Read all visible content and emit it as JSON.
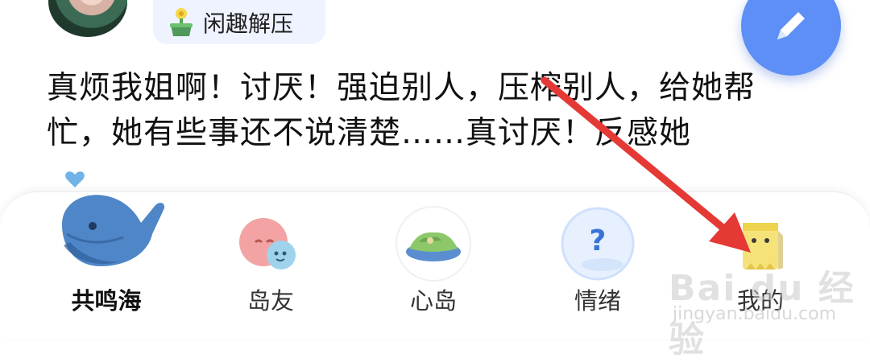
{
  "post": {
    "category_tag": "闲趣解压",
    "text": "真烦我姐啊！讨厌！强迫别人，压榨别人，给她帮忙，她有些事还不说清楚……真讨厌！反感她"
  },
  "fab": {
    "icon": "pencil-icon",
    "color": "#5d8ff6"
  },
  "tabbar": {
    "tabs": [
      {
        "label": "共鸣海",
        "icon": "whale-icon",
        "active": true
      },
      {
        "label": "岛友",
        "icon": "chat-bubble-icon",
        "active": false
      },
      {
        "label": "心岛",
        "icon": "island-icon",
        "active": false
      },
      {
        "label": "情绪",
        "icon": "question-bubble-icon",
        "active": false
      },
      {
        "label": "我的",
        "icon": "profile-box-icon",
        "active": false
      }
    ]
  },
  "watermark": {
    "brand": "Bai du 经验",
    "url": "jingyan.baidu.com"
  },
  "annotation": {
    "arrow_color": "#e53935"
  }
}
